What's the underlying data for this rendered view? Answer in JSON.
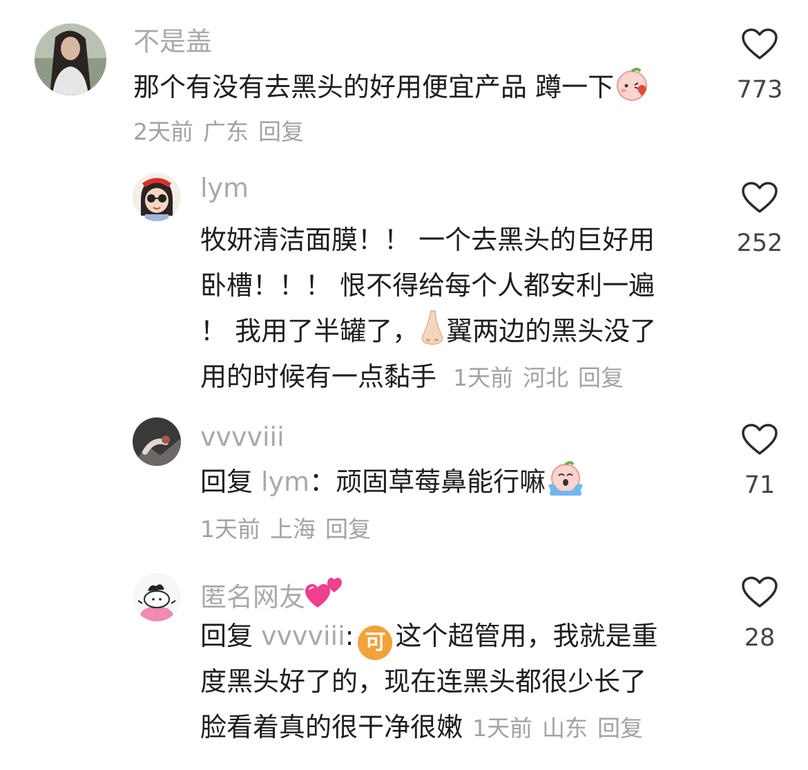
{
  "comments": [
    {
      "username": "不是盖",
      "text_line1": "那个有没有去黑头的好用便宜产品 蹲一下",
      "time": "2天前",
      "location": "广东",
      "reply_label": "回复",
      "likes": "773",
      "avatar_icon": "avatar-photo-woman-long-hair",
      "emoji": "peach-blowing-kiss-emoji"
    },
    {
      "username": "lym",
      "lines": [
        "牧妍清洁面膜！！ 一个去黑头的巨好用",
        "卧槽！！！ 恨不得给每个人都安利一遍",
        "！ 我用了半罐了，",
        "用的时候有一点黏手"
      ],
      "line3_tail": "翼两边的黑头没了",
      "time": "1天前",
      "location": "河北",
      "reply_label": "回复",
      "likes": "252",
      "avatar_icon": "avatar-girl-sunglasses",
      "emoji": "nose-emoji"
    },
    {
      "username": "vvvviii",
      "reply_prefix": "回复",
      "reply_target": "lym",
      "colon": "：",
      "text_line1": "顽固草莓鼻能行嘛",
      "time": "1天前",
      "location": "上海",
      "reply_label": "回复",
      "likes": "71",
      "avatar_icon": "avatar-photo-dark",
      "emoji": "peach-crying-emoji"
    },
    {
      "username": "匿名网友",
      "reply_prefix": "回复",
      "reply_target": "vvvviii",
      "colon": ":",
      "badge_text": "可",
      "lines": [
        "这个超管用，我就是重",
        "度黑头好了的，现在连黑头都很少长了",
        "脸看着真的很干净很嫩"
      ],
      "time": "1天前",
      "location": "山东",
      "reply_label": "回复",
      "likes": "28",
      "avatar_icon": "avatar-cartoon-character",
      "emoji": "two-hearts-emoji"
    }
  ],
  "colors": {
    "username": "#a9a9a9",
    "text": "#1d1d1d",
    "meta": "#a2a2a2",
    "badge": "#f0a33a"
  },
  "icons": {
    "like": "heart-outline-icon"
  }
}
